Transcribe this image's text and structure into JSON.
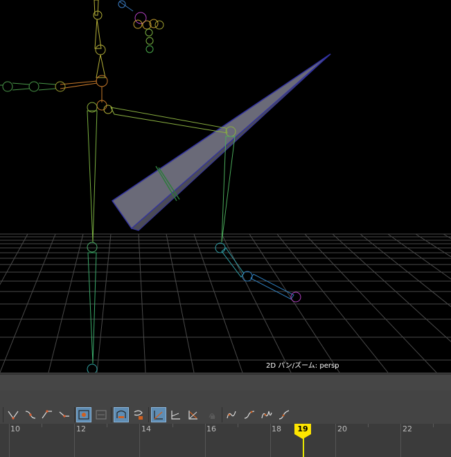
{
  "viewport": {
    "hud_label": "2D パン/ズーム: persp"
  },
  "graph_editor": {
    "toolbar_icons": [
      {
        "name": "tangent-auto-icon"
      },
      {
        "name": "tangent-spline-icon"
      },
      {
        "name": "tangent-linear-icon"
      },
      {
        "name": "tangent-flat-icon"
      },
      {
        "name": "buffer-curve-snapshot-icon",
        "active": true
      },
      {
        "name": "buffer-curve-swap-icon"
      },
      {
        "name": "normalize-icon",
        "active": true
      },
      {
        "name": "denormalize-icon"
      },
      {
        "name": "break-tangents-icon",
        "active": true
      },
      {
        "name": "unify-tangents-icon"
      },
      {
        "name": "free-tangent-weight-icon"
      },
      {
        "name": "lock-tangent-weight-icon"
      },
      {
        "name": "pre-infinity-icon"
      },
      {
        "name": "post-infinity-icon"
      },
      {
        "name": "pre-post-cycle-icon"
      },
      {
        "name": "cycle-offset-icon"
      }
    ],
    "timeline": {
      "ticks": [
        "10",
        "12",
        "14",
        "16",
        "18",
        "20",
        "22"
      ],
      "current_frame": "19"
    },
    "colors": {
      "playhead": "#ffe600",
      "active_button": "#5f8db4"
    }
  }
}
